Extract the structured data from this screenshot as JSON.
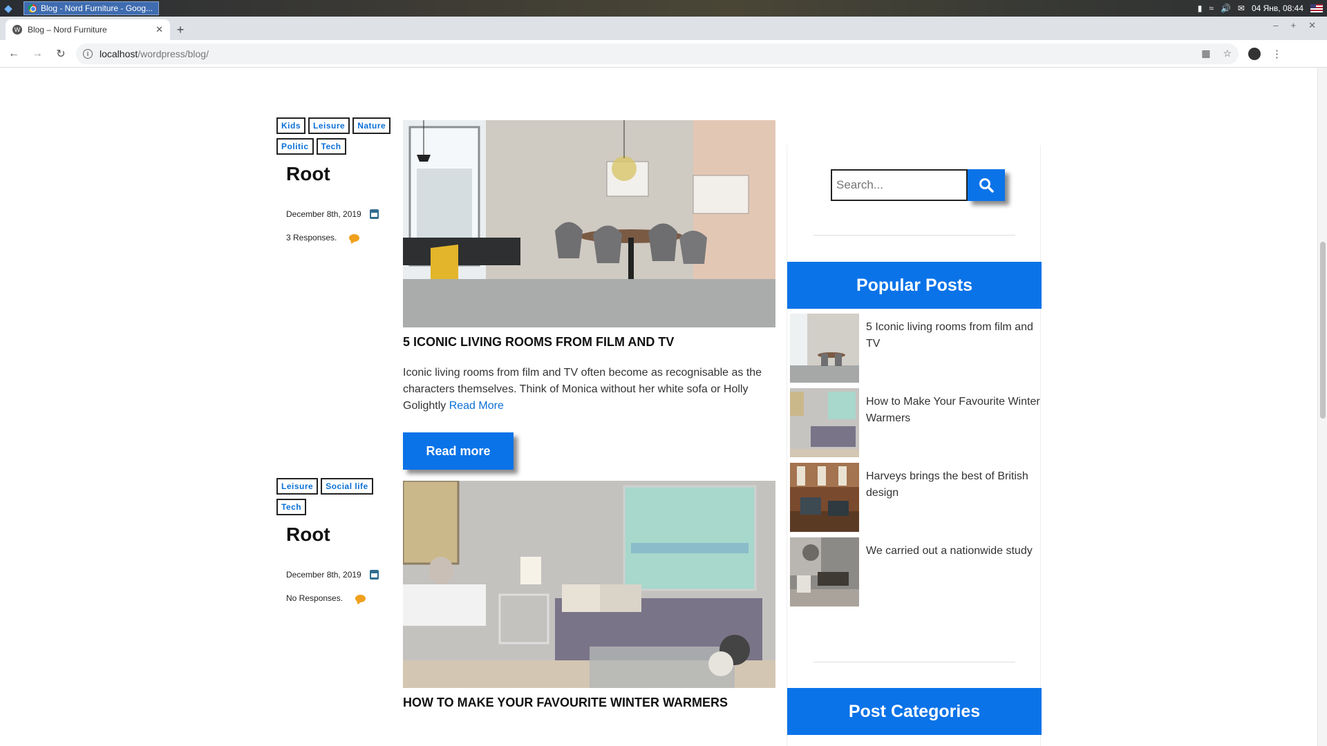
{
  "taskbar": {
    "task_title": "Blog - Nord Furniture - Goog...",
    "clock": "04 Янв, 08:44"
  },
  "browser": {
    "tab_title": "Blog – Nord Furniture",
    "url_host": "localhost",
    "url_path": "/wordpress/blog/"
  },
  "posts": [
    {
      "tags": [
        "Kids",
        "Leisure",
        "Nature",
        "Politic",
        "Tech"
      ],
      "author": "Root",
      "date": "December 8th, 2019",
      "responses": "3 Responses.",
      "title": "5 ICONIC LIVING ROOMS FROM FILM AND TV",
      "excerpt": "Iconic living rooms from film and TV often become as recognisable as the characters themselves. Think of Monica without her white sofa or Holly Golightly",
      "excerpt_link": "Read More",
      "button": "Read more"
    },
    {
      "tags": [
        "Leisure",
        "Social life",
        "Tech"
      ],
      "author": "Root",
      "date": "December 8th, 2019",
      "responses": "No Responses.",
      "title": "HOW TO MAKE YOUR FAVOURITE WINTER WARMERS"
    }
  ],
  "sidebar": {
    "search_placeholder": "Search...",
    "popular_heading": "Popular Posts",
    "popular": [
      "5 Iconic living rooms from film and TV",
      "How to Make Your Favourite Winter Warmers",
      "Harveys brings the best of British design",
      "We carried out a nationwide study"
    ],
    "categories_heading": "Post Categories"
  },
  "colors": {
    "accent": "#0a73e8",
    "tag_text": "#0a6fd6",
    "calendar": "#2f6d8f",
    "comment": "#f0a01c"
  }
}
